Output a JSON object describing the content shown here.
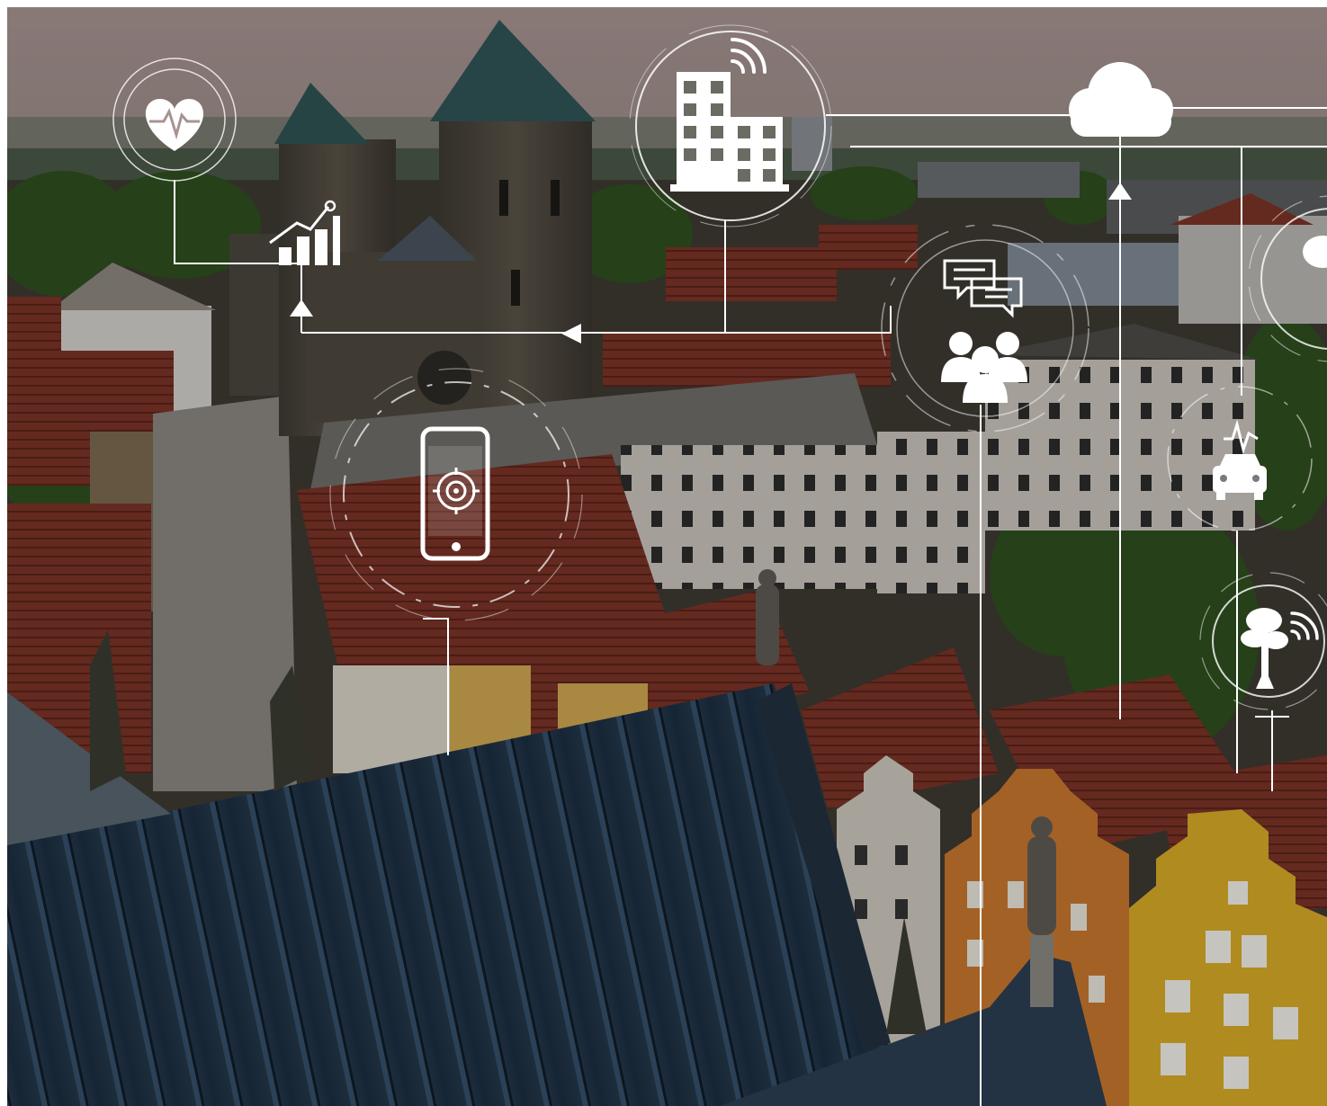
{
  "scene": {
    "description_colors": {
      "sky": "#a89492",
      "overlay_line": "#ffffff",
      "roof_red": "#7a3327",
      "roof_dark": "#1f3346",
      "foliage": "#2f4f1f",
      "facade_light": "#c9c4bb",
      "facade_yellow": "#d6a92a",
      "facade_orange": "#c9772e",
      "stone": "#4f4a42"
    },
    "icons": [
      "heart-monitor-icon",
      "growth-chart-icon",
      "smart-building-icon",
      "cloud-icon",
      "chat-bubbles-icon",
      "people-group-icon",
      "smartphone-target-icon",
      "connected-car-icon",
      "smart-tree-icon",
      "smart-tree-edge-icon"
    ]
  }
}
